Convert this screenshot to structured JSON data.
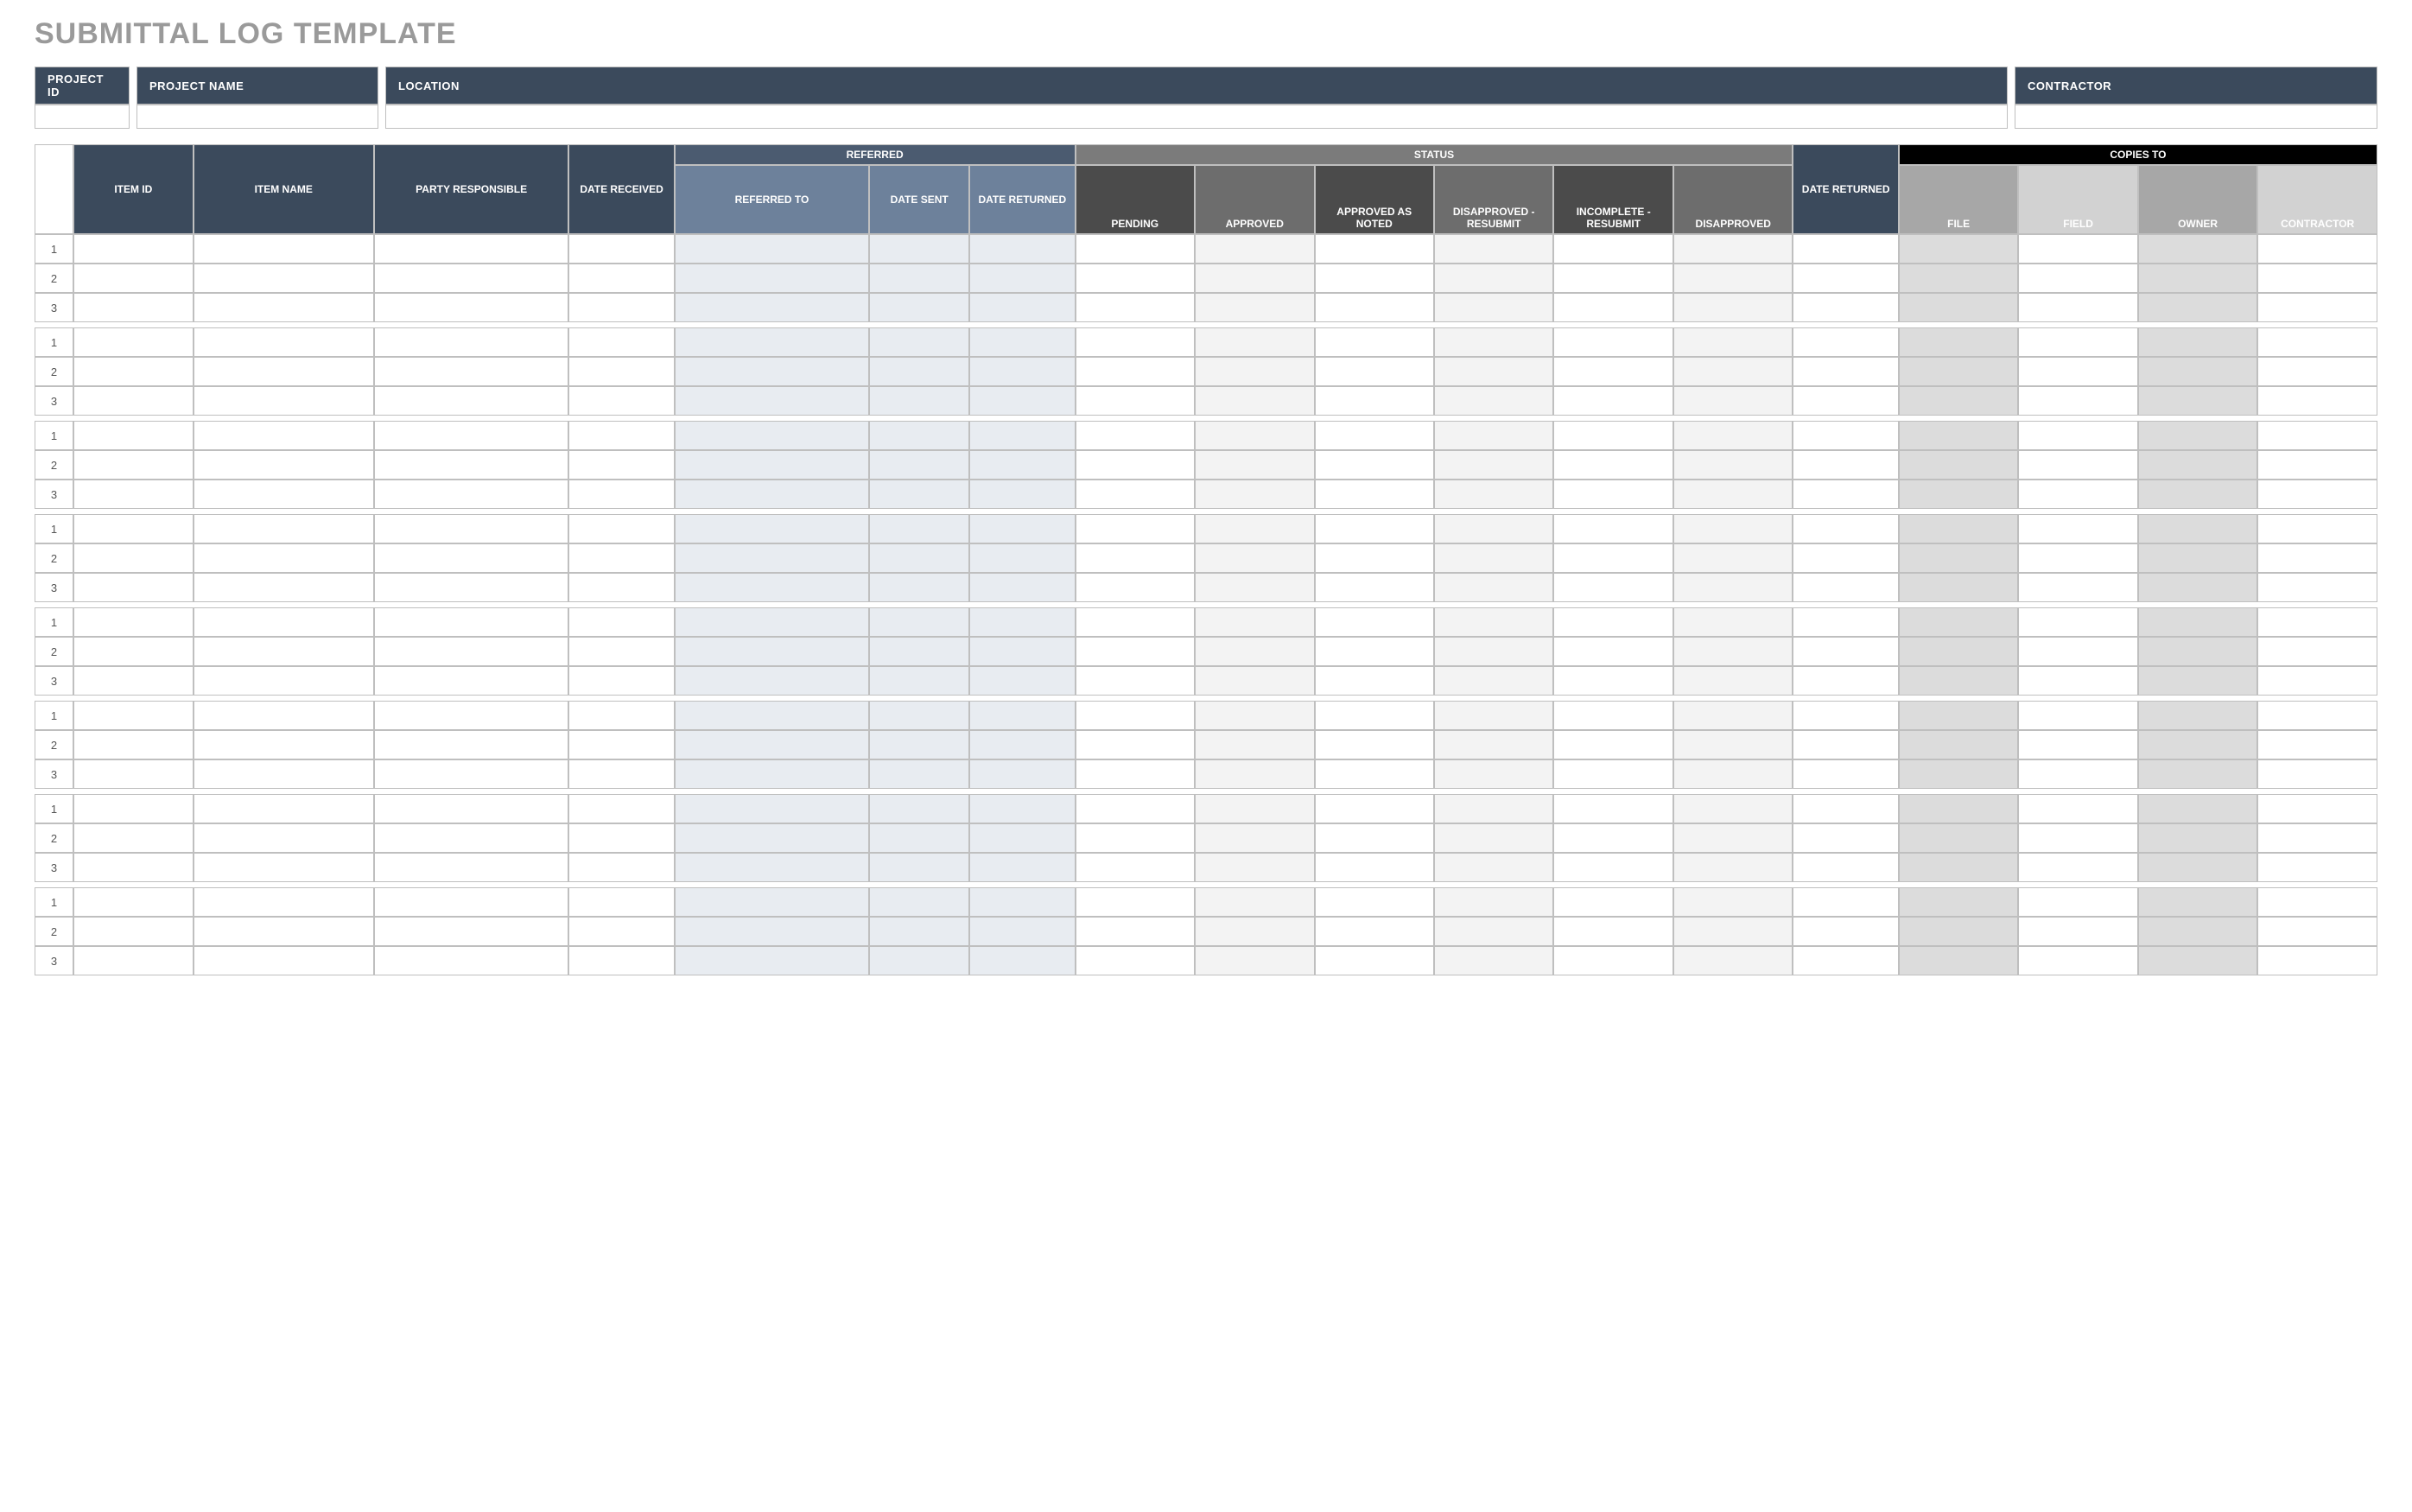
{
  "title": "SUBMITTAL LOG TEMPLATE",
  "info_headers": {
    "project_id": "PROJECT ID",
    "project_name": "PROJECT NAME",
    "location": "LOCATION",
    "contractor": "CONTRACTOR"
  },
  "info_values": {
    "project_id": "",
    "project_name": "",
    "location": "",
    "contractor": ""
  },
  "group_headers": {
    "referred": "REFERRED",
    "status": "STATUS",
    "copies_to": "COPIES TO"
  },
  "col_headers": {
    "item_id": "ITEM ID",
    "item_name": "ITEM NAME",
    "party_responsible": "PARTY RESPONSIBLE",
    "date_received": "DATE RECEIVED",
    "referred_to": "REFERRED TO",
    "date_sent": "DATE SENT",
    "date_returned_ref": "DATE RETURNED",
    "pending": "PENDING",
    "approved": "APPROVED",
    "approved_as_noted": "APPROVED AS NOTED",
    "disapproved_resubmit": "DISAPPROVED - RESUBMIT",
    "incomplete_resubmit": "INCOMPLETE - RESUBMIT",
    "disapproved": "DISAPPROVED",
    "date_returned": "DATE RETURNED",
    "file": "FILE",
    "field": "FIELD",
    "owner": "OWNER",
    "contractor": "CONTRACTOR"
  },
  "groups": [
    [
      {
        "rownum": "1",
        "item_id": "",
        "item_name": "",
        "party_responsible": "",
        "date_received": "",
        "referred_to": "",
        "date_sent": "",
        "date_returned_ref": "",
        "pending": "",
        "approved": "",
        "approved_as_noted": "",
        "disapproved_resubmit": "",
        "incomplete_resubmit": "",
        "disapproved": "",
        "date_returned": "",
        "file": "",
        "field": "",
        "owner": "",
        "contractor": ""
      },
      {
        "rownum": "2",
        "item_id": "",
        "item_name": "",
        "party_responsible": "",
        "date_received": "",
        "referred_to": "",
        "date_sent": "",
        "date_returned_ref": "",
        "pending": "",
        "approved": "",
        "approved_as_noted": "",
        "disapproved_resubmit": "",
        "incomplete_resubmit": "",
        "disapproved": "",
        "date_returned": "",
        "file": "",
        "field": "",
        "owner": "",
        "contractor": ""
      },
      {
        "rownum": "3",
        "item_id": "",
        "item_name": "",
        "party_responsible": "",
        "date_received": "",
        "referred_to": "",
        "date_sent": "",
        "date_returned_ref": "",
        "pending": "",
        "approved": "",
        "approved_as_noted": "",
        "disapproved_resubmit": "",
        "incomplete_resubmit": "",
        "disapproved": "",
        "date_returned": "",
        "file": "",
        "field": "",
        "owner": "",
        "contractor": ""
      }
    ],
    [
      {
        "rownum": "1",
        "item_id": "",
        "item_name": "",
        "party_responsible": "",
        "date_received": "",
        "referred_to": "",
        "date_sent": "",
        "date_returned_ref": "",
        "pending": "",
        "approved": "",
        "approved_as_noted": "",
        "disapproved_resubmit": "",
        "incomplete_resubmit": "",
        "disapproved": "",
        "date_returned": "",
        "file": "",
        "field": "",
        "owner": "",
        "contractor": ""
      },
      {
        "rownum": "2",
        "item_id": "",
        "item_name": "",
        "party_responsible": "",
        "date_received": "",
        "referred_to": "",
        "date_sent": "",
        "date_returned_ref": "",
        "pending": "",
        "approved": "",
        "approved_as_noted": "",
        "disapproved_resubmit": "",
        "incomplete_resubmit": "",
        "disapproved": "",
        "date_returned": "",
        "file": "",
        "field": "",
        "owner": "",
        "contractor": ""
      },
      {
        "rownum": "3",
        "item_id": "",
        "item_name": "",
        "party_responsible": "",
        "date_received": "",
        "referred_to": "",
        "date_sent": "",
        "date_returned_ref": "",
        "pending": "",
        "approved": "",
        "approved_as_noted": "",
        "disapproved_resubmit": "",
        "incomplete_resubmit": "",
        "disapproved": "",
        "date_returned": "",
        "file": "",
        "field": "",
        "owner": "",
        "contractor": ""
      }
    ],
    [
      {
        "rownum": "1",
        "item_id": "",
        "item_name": "",
        "party_responsible": "",
        "date_received": "",
        "referred_to": "",
        "date_sent": "",
        "date_returned_ref": "",
        "pending": "",
        "approved": "",
        "approved_as_noted": "",
        "disapproved_resubmit": "",
        "incomplete_resubmit": "",
        "disapproved": "",
        "date_returned": "",
        "file": "",
        "field": "",
        "owner": "",
        "contractor": ""
      },
      {
        "rownum": "2",
        "item_id": "",
        "item_name": "",
        "party_responsible": "",
        "date_received": "",
        "referred_to": "",
        "date_sent": "",
        "date_returned_ref": "",
        "pending": "",
        "approved": "",
        "approved_as_noted": "",
        "disapproved_resubmit": "",
        "incomplete_resubmit": "",
        "disapproved": "",
        "date_returned": "",
        "file": "",
        "field": "",
        "owner": "",
        "contractor": ""
      },
      {
        "rownum": "3",
        "item_id": "",
        "item_name": "",
        "party_responsible": "",
        "date_received": "",
        "referred_to": "",
        "date_sent": "",
        "date_returned_ref": "",
        "pending": "",
        "approved": "",
        "approved_as_noted": "",
        "disapproved_resubmit": "",
        "incomplete_resubmit": "",
        "disapproved": "",
        "date_returned": "",
        "file": "",
        "field": "",
        "owner": "",
        "contractor": ""
      }
    ],
    [
      {
        "rownum": "1",
        "item_id": "",
        "item_name": "",
        "party_responsible": "",
        "date_received": "",
        "referred_to": "",
        "date_sent": "",
        "date_returned_ref": "",
        "pending": "",
        "approved": "",
        "approved_as_noted": "",
        "disapproved_resubmit": "",
        "incomplete_resubmit": "",
        "disapproved": "",
        "date_returned": "",
        "file": "",
        "field": "",
        "owner": "",
        "contractor": ""
      },
      {
        "rownum": "2",
        "item_id": "",
        "item_name": "",
        "party_responsible": "",
        "date_received": "",
        "referred_to": "",
        "date_sent": "",
        "date_returned_ref": "",
        "pending": "",
        "approved": "",
        "approved_as_noted": "",
        "disapproved_resubmit": "",
        "incomplete_resubmit": "",
        "disapproved": "",
        "date_returned": "",
        "file": "",
        "field": "",
        "owner": "",
        "contractor": ""
      },
      {
        "rownum": "3",
        "item_id": "",
        "item_name": "",
        "party_responsible": "",
        "date_received": "",
        "referred_to": "",
        "date_sent": "",
        "date_returned_ref": "",
        "pending": "",
        "approved": "",
        "approved_as_noted": "",
        "disapproved_resubmit": "",
        "incomplete_resubmit": "",
        "disapproved": "",
        "date_returned": "",
        "file": "",
        "field": "",
        "owner": "",
        "contractor": ""
      }
    ],
    [
      {
        "rownum": "1",
        "item_id": "",
        "item_name": "",
        "party_responsible": "",
        "date_received": "",
        "referred_to": "",
        "date_sent": "",
        "date_returned_ref": "",
        "pending": "",
        "approved": "",
        "approved_as_noted": "",
        "disapproved_resubmit": "",
        "incomplete_resubmit": "",
        "disapproved": "",
        "date_returned": "",
        "file": "",
        "field": "",
        "owner": "",
        "contractor": ""
      },
      {
        "rownum": "2",
        "item_id": "",
        "item_name": "",
        "party_responsible": "",
        "date_received": "",
        "referred_to": "",
        "date_sent": "",
        "date_returned_ref": "",
        "pending": "",
        "approved": "",
        "approved_as_noted": "",
        "disapproved_resubmit": "",
        "incomplete_resubmit": "",
        "disapproved": "",
        "date_returned": "",
        "file": "",
        "field": "",
        "owner": "",
        "contractor": ""
      },
      {
        "rownum": "3",
        "item_id": "",
        "item_name": "",
        "party_responsible": "",
        "date_received": "",
        "referred_to": "",
        "date_sent": "",
        "date_returned_ref": "",
        "pending": "",
        "approved": "",
        "approved_as_noted": "",
        "disapproved_resubmit": "",
        "incomplete_resubmit": "",
        "disapproved": "",
        "date_returned": "",
        "file": "",
        "field": "",
        "owner": "",
        "contractor": ""
      }
    ],
    [
      {
        "rownum": "1",
        "item_id": "",
        "item_name": "",
        "party_responsible": "",
        "date_received": "",
        "referred_to": "",
        "date_sent": "",
        "date_returned_ref": "",
        "pending": "",
        "approved": "",
        "approved_as_noted": "",
        "disapproved_resubmit": "",
        "incomplete_resubmit": "",
        "disapproved": "",
        "date_returned": "",
        "file": "",
        "field": "",
        "owner": "",
        "contractor": ""
      },
      {
        "rownum": "2",
        "item_id": "",
        "item_name": "",
        "party_responsible": "",
        "date_received": "",
        "referred_to": "",
        "date_sent": "",
        "date_returned_ref": "",
        "pending": "",
        "approved": "",
        "approved_as_noted": "",
        "disapproved_resubmit": "",
        "incomplete_resubmit": "",
        "disapproved": "",
        "date_returned": "",
        "file": "",
        "field": "",
        "owner": "",
        "contractor": ""
      },
      {
        "rownum": "3",
        "item_id": "",
        "item_name": "",
        "party_responsible": "",
        "date_received": "",
        "referred_to": "",
        "date_sent": "",
        "date_returned_ref": "",
        "pending": "",
        "approved": "",
        "approved_as_noted": "",
        "disapproved_resubmit": "",
        "incomplete_resubmit": "",
        "disapproved": "",
        "date_returned": "",
        "file": "",
        "field": "",
        "owner": "",
        "contractor": ""
      }
    ],
    [
      {
        "rownum": "1",
        "item_id": "",
        "item_name": "",
        "party_responsible": "",
        "date_received": "",
        "referred_to": "",
        "date_sent": "",
        "date_returned_ref": "",
        "pending": "",
        "approved": "",
        "approved_as_noted": "",
        "disapproved_resubmit": "",
        "incomplete_resubmit": "",
        "disapproved": "",
        "date_returned": "",
        "file": "",
        "field": "",
        "owner": "",
        "contractor": ""
      },
      {
        "rownum": "2",
        "item_id": "",
        "item_name": "",
        "party_responsible": "",
        "date_received": "",
        "referred_to": "",
        "date_sent": "",
        "date_returned_ref": "",
        "pending": "",
        "approved": "",
        "approved_as_noted": "",
        "disapproved_resubmit": "",
        "incomplete_resubmit": "",
        "disapproved": "",
        "date_returned": "",
        "file": "",
        "field": "",
        "owner": "",
        "contractor": ""
      },
      {
        "rownum": "3",
        "item_id": "",
        "item_name": "",
        "party_responsible": "",
        "date_received": "",
        "referred_to": "",
        "date_sent": "",
        "date_returned_ref": "",
        "pending": "",
        "approved": "",
        "approved_as_noted": "",
        "disapproved_resubmit": "",
        "incomplete_resubmit": "",
        "disapproved": "",
        "date_returned": "",
        "file": "",
        "field": "",
        "owner": "",
        "contractor": ""
      }
    ],
    [
      {
        "rownum": "1",
        "item_id": "",
        "item_name": "",
        "party_responsible": "",
        "date_received": "",
        "referred_to": "",
        "date_sent": "",
        "date_returned_ref": "",
        "pending": "",
        "approved": "",
        "approved_as_noted": "",
        "disapproved_resubmit": "",
        "incomplete_resubmit": "",
        "disapproved": "",
        "date_returned": "",
        "file": "",
        "field": "",
        "owner": "",
        "contractor": ""
      },
      {
        "rownum": "2",
        "item_id": "",
        "item_name": "",
        "party_responsible": "",
        "date_received": "",
        "referred_to": "",
        "date_sent": "",
        "date_returned_ref": "",
        "pending": "",
        "approved": "",
        "approved_as_noted": "",
        "disapproved_resubmit": "",
        "incomplete_resubmit": "",
        "disapproved": "",
        "date_returned": "",
        "file": "",
        "field": "",
        "owner": "",
        "contractor": ""
      },
      {
        "rownum": "3",
        "item_id": "",
        "item_name": "",
        "party_responsible": "",
        "date_received": "",
        "referred_to": "",
        "date_sent": "",
        "date_returned_ref": "",
        "pending": "",
        "approved": "",
        "approved_as_noted": "",
        "disapproved_resubmit": "",
        "incomplete_resubmit": "",
        "disapproved": "",
        "date_returned": "",
        "file": "",
        "field": "",
        "owner": "",
        "contractor": ""
      }
    ]
  ]
}
